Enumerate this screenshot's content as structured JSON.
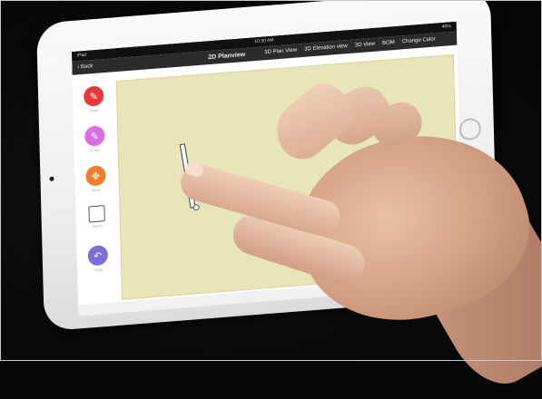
{
  "status_bar": {
    "carrier": "iPad",
    "time": "10:30 AM",
    "battery": "40%"
  },
  "nav_bar": {
    "back_label": "Back",
    "title": "2D Planview",
    "menu": [
      "3D Plan View",
      "3D Elevation view",
      "3D View",
      "BOM",
      "Change Color"
    ]
  },
  "tools": [
    {
      "icon": "pencil-icon",
      "color": "#e8383d",
      "caption": "Draw"
    },
    {
      "icon": "eraser-icon",
      "color": "#d86ee0",
      "caption": "Erase"
    },
    {
      "icon": "move-icon",
      "color": "#f07d2a",
      "caption": "Move"
    },
    {
      "icon": "select-frame-icon",
      "color": "#ffffff",
      "caption": "Select"
    },
    {
      "icon": "undo-icon",
      "color": "#7a6fd6",
      "caption": "Undo"
    }
  ],
  "colors": {
    "canvas": "#e8e6b8",
    "nav": "#2b2b2b"
  }
}
